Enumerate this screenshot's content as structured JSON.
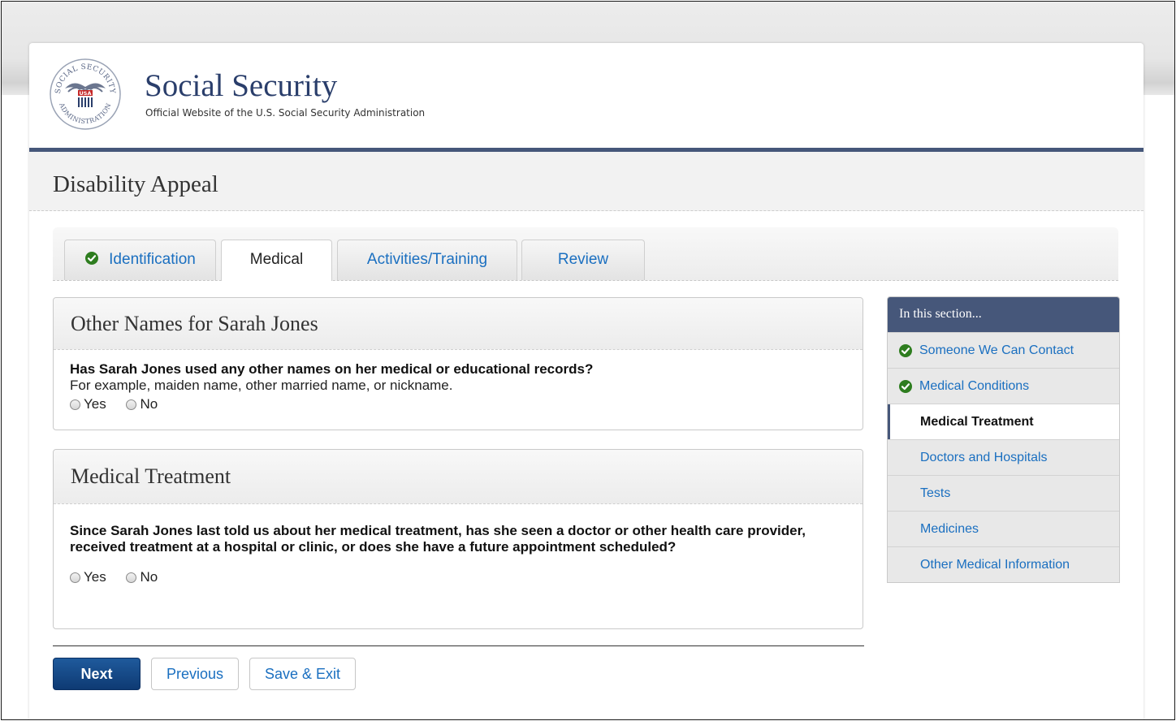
{
  "site": {
    "title": "Social Security",
    "subtitle": "Official Website of the U.S. Social Security Administration",
    "seal_text": [
      "SOCIAL SECURITY",
      "ADMINISTRATION",
      "USA"
    ]
  },
  "app": {
    "title": "Disability Appeal"
  },
  "tabs": [
    {
      "label": "Identification",
      "completed": true,
      "active": false
    },
    {
      "label": "Medical",
      "completed": false,
      "active": true
    },
    {
      "label": "Activities/Training",
      "completed": false,
      "active": false
    },
    {
      "label": "Review",
      "completed": false,
      "active": false
    }
  ],
  "sections": [
    {
      "heading": "Other Names for Sarah Jones",
      "question": "Has Sarah Jones used any other names on her medical or educational records?",
      "hint": "For example, maiden name, other married name, or nickname.",
      "options": [
        "Yes",
        "No"
      ]
    },
    {
      "heading": "Medical Treatment",
      "question": "Since Sarah Jones last told us about her medical treatment, has she seen a doctor or other health care provider, received treatment at a hospital or clinic, or does she have a future appointment scheduled?",
      "options": [
        "Yes",
        "No"
      ]
    }
  ],
  "buttons": {
    "next": "Next",
    "previous": "Previous",
    "save_exit": "Save & Exit"
  },
  "sidebar": {
    "heading": "In this section...",
    "items": [
      {
        "label": "Someone We Can Contact",
        "status": "completed"
      },
      {
        "label": "Medical Conditions",
        "status": "completed"
      },
      {
        "label": "Medical Treatment",
        "status": "current"
      },
      {
        "label": "Doctors and Hospitals",
        "status": "pending"
      },
      {
        "label": "Tests",
        "status": "pending"
      },
      {
        "label": "Medicines",
        "status": "pending"
      },
      {
        "label": "Other Medical Information",
        "status": "pending"
      }
    ]
  },
  "colors": {
    "navy": "#46577a",
    "link": "#1a6fc0",
    "check": "#2e7d1f",
    "primary_button": "#0e3a73"
  }
}
